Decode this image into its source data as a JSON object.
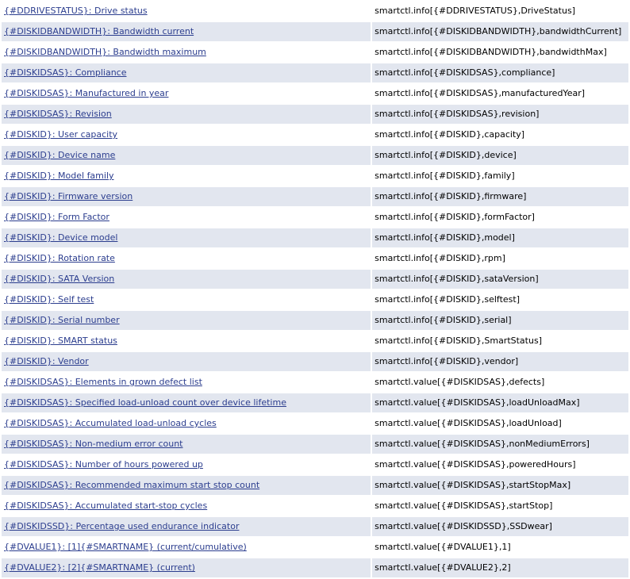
{
  "rows": [
    {
      "name": "{#DDRIVESTATUS}: Drive status",
      "key": "smartctl.info[{#DDRIVESTATUS},DriveStatus]"
    },
    {
      "name": "{#DISKIDBANDWIDTH}: Bandwidth current",
      "key": "smartctl.info[{#DISKIDBANDWIDTH},bandwidthCurrent]"
    },
    {
      "name": "{#DISKIDBANDWIDTH}: Bandwidth maximum",
      "key": "smartctl.info[{#DISKIDBANDWIDTH},bandwidthMax]"
    },
    {
      "name": "{#DISKIDSAS}: Compliance",
      "key": "smartctl.info[{#DISKIDSAS},compliance]"
    },
    {
      "name": "{#DISKIDSAS}: Manufactured in year",
      "key": "smartctl.info[{#DISKIDSAS},manufacturedYear]"
    },
    {
      "name": "{#DISKIDSAS}: Revision",
      "key": "smartctl.info[{#DISKIDSAS},revision]"
    },
    {
      "name": "{#DISKID}: User capacity",
      "key": "smartctl.info[{#DISKID},capacity]"
    },
    {
      "name": "{#DISKID}: Device name",
      "key": "smartctl.info[{#DISKID},device]"
    },
    {
      "name": "{#DISKID}: Model family",
      "key": "smartctl.info[{#DISKID},family]"
    },
    {
      "name": "{#DISKID}: Firmware version",
      "key": "smartctl.info[{#DISKID},firmware]"
    },
    {
      "name": "{#DISKID}: Form Factor",
      "key": "smartctl.info[{#DISKID},formFactor]"
    },
    {
      "name": "{#DISKID}: Device model",
      "key": "smartctl.info[{#DISKID},model]"
    },
    {
      "name": "{#DISKID}: Rotation rate",
      "key": "smartctl.info[{#DISKID},rpm]"
    },
    {
      "name": "{#DISKID}: SATA Version",
      "key": "smartctl.info[{#DISKID},sataVersion]"
    },
    {
      "name": "{#DISKID}: Self test",
      "key": "smartctl.info[{#DISKID},selftest]"
    },
    {
      "name": "{#DISKID}: Serial number",
      "key": "smartctl.info[{#DISKID},serial]"
    },
    {
      "name": "{#DISKID}: SMART status",
      "key": "smartctl.info[{#DISKID},SmartStatus]"
    },
    {
      "name": "{#DISKID}: Vendor",
      "key": "smartctl.info[{#DISKID},vendor]"
    },
    {
      "name": "{#DISKIDSAS}: Elements in grown defect list",
      "key": "smartctl.value[{#DISKIDSAS},defects]"
    },
    {
      "name": "{#DISKIDSAS}: Specified load-unload count over device lifetime",
      "key": "smartctl.value[{#DISKIDSAS},loadUnloadMax]"
    },
    {
      "name": "{#DISKIDSAS}: Accumulated load-unload cycles",
      "key": "smartctl.value[{#DISKIDSAS},loadUnload]"
    },
    {
      "name": "{#DISKIDSAS}: Non-medium error count",
      "key": "smartctl.value[{#DISKIDSAS},nonMediumErrors]"
    },
    {
      "name": "{#DISKIDSAS}: Number of hours powered up",
      "key": "smartctl.value[{#DISKIDSAS},poweredHours]"
    },
    {
      "name": "{#DISKIDSAS}: Recommended maximum start stop count",
      "key": "smartctl.value[{#DISKIDSAS},startStopMax]"
    },
    {
      "name": "{#DISKIDSAS}: Accumulated start-stop cycles",
      "key": "smartctl.value[{#DISKIDSAS},startStop]"
    },
    {
      "name": "{#DISKIDSSD}: Percentage used endurance indicator",
      "key": "smartctl.value[{#DISKIDSSD},SSDwear]"
    },
    {
      "name": "{#DVALUE1}: [1]{#SMARTNAME} (current/cumulative)",
      "key": "smartctl.value[{#DVALUE1},1]"
    },
    {
      "name": "{#DVALUE2}: [2]{#SMARTNAME} (current)",
      "key": "smartctl.value[{#DVALUE2},2]"
    }
  ]
}
